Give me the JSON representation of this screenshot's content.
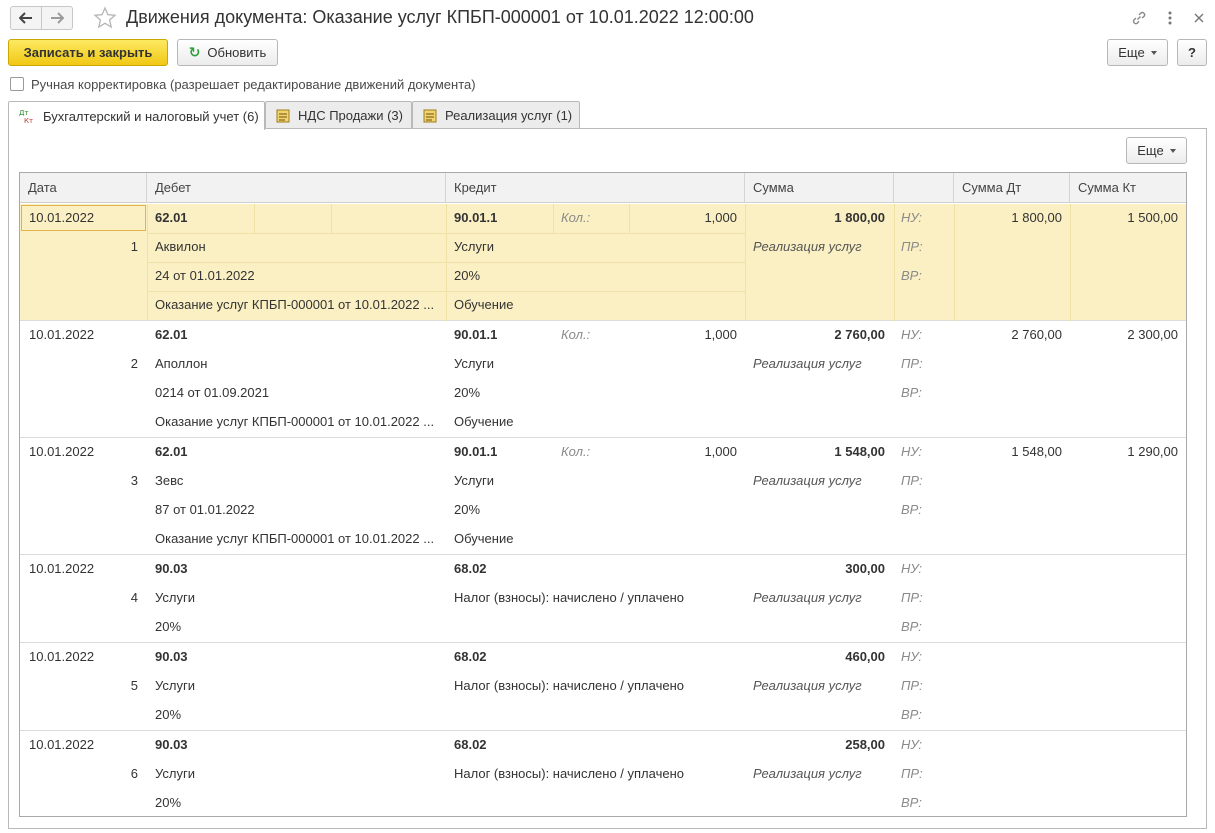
{
  "window": {
    "title": "Движения документа: Оказание услуг КПБП-000001 от 10.01.2022 12:00:00"
  },
  "toolbar": {
    "save_close_label": "Записать и закрыть",
    "refresh_label": "Обновить",
    "more_label": "Еще",
    "help_label": "?"
  },
  "manual_correction": {
    "label": "Ручная корректировка (разрешает редактирование движений документа)",
    "checked": false
  },
  "tabs": [
    {
      "label": "Бухгалтерский и налоговый учет (6)",
      "active": true
    },
    {
      "label": "НДС Продажи (3)",
      "active": false
    },
    {
      "label": "Реализация услуг (1)",
      "active": false
    }
  ],
  "table_more_label": "Еще",
  "columns": {
    "date": "Дата",
    "debit": "Дебет",
    "credit": "Кредит",
    "sum": "Сумма",
    "blank": "",
    "sum_dt": "Сумма Дт",
    "sum_kt": "Сумма Кт"
  },
  "records": [
    {
      "date": "10.01.2022",
      "num": "1",
      "debit_lines": [
        "62.01",
        "Аквилон",
        "24 от 01.01.2022",
        "Оказание услуг КПБП-000001 от 10.01.2022 ..."
      ],
      "credit_lines": [
        "90.01.1",
        "Услуги",
        "20%",
        "Обучение"
      ],
      "qty_label": "Кол.:",
      "qty": "1,000",
      "sum": "1 800,00",
      "content": "Реализация услуг",
      "nu": "НУ:",
      "pr": "ПР:",
      "vr": "ВР:",
      "sum_dt": "1 800,00",
      "sum_kt": "1 500,00"
    },
    {
      "date": "10.01.2022",
      "num": "2",
      "debit_lines": [
        "62.01",
        "Аполлон",
        "0214 от 01.09.2021",
        "Оказание услуг КПБП-000001 от 10.01.2022 ..."
      ],
      "credit_lines": [
        "90.01.1",
        "Услуги",
        "20%",
        "Обучение"
      ],
      "qty_label": "Кол.:",
      "qty": "1,000",
      "sum": "2 760,00",
      "content": "Реализация услуг",
      "nu": "НУ:",
      "pr": "ПР:",
      "vr": "ВР:",
      "sum_dt": "2 760,00",
      "sum_kt": "2 300,00"
    },
    {
      "date": "10.01.2022",
      "num": "3",
      "debit_lines": [
        "62.01",
        "Зевс",
        "87 от 01.01.2022",
        "Оказание услуг КПБП-000001 от 10.01.2022 ..."
      ],
      "credit_lines": [
        "90.01.1",
        "Услуги",
        "20%",
        "Обучение"
      ],
      "qty_label": "Кол.:",
      "qty": "1,000",
      "sum": "1 548,00",
      "content": "Реализация услуг",
      "nu": "НУ:",
      "pr": "ПР:",
      "vr": "ВР:",
      "sum_dt": "1 548,00",
      "sum_kt": "1 290,00"
    },
    {
      "date": "10.01.2022",
      "num": "4",
      "debit_lines": [
        "90.03",
        "Услуги",
        "20%"
      ],
      "credit_lines": [
        "68.02",
        "Налог (взносы): начислено / уплачено"
      ],
      "qty_label": "",
      "qty": "",
      "sum": "300,00",
      "content": "Реализация услуг",
      "nu": "НУ:",
      "pr": "ПР:",
      "vr": "ВР:",
      "sum_dt": "",
      "sum_kt": ""
    },
    {
      "date": "10.01.2022",
      "num": "5",
      "debit_lines": [
        "90.03",
        "Услуги",
        "20%"
      ],
      "credit_lines": [
        "68.02",
        "Налог (взносы): начислено / уплачено"
      ],
      "qty_label": "",
      "qty": "",
      "sum": "460,00",
      "content": "Реализация услуг",
      "nu": "НУ:",
      "pr": "ПР:",
      "vr": "ВР:",
      "sum_dt": "",
      "sum_kt": ""
    },
    {
      "date": "10.01.2022",
      "num": "6",
      "debit_lines": [
        "90.03",
        "Услуги",
        "20%"
      ],
      "credit_lines": [
        "68.02",
        "Налог (взносы): начислено / уплачено"
      ],
      "qty_label": "",
      "qty": "",
      "sum": "258,00",
      "content": "Реализация услуг",
      "nu": "НУ:",
      "pr": "ПР:",
      "vr": "ВР:",
      "sum_dt": "",
      "sum_kt": ""
    }
  ]
}
